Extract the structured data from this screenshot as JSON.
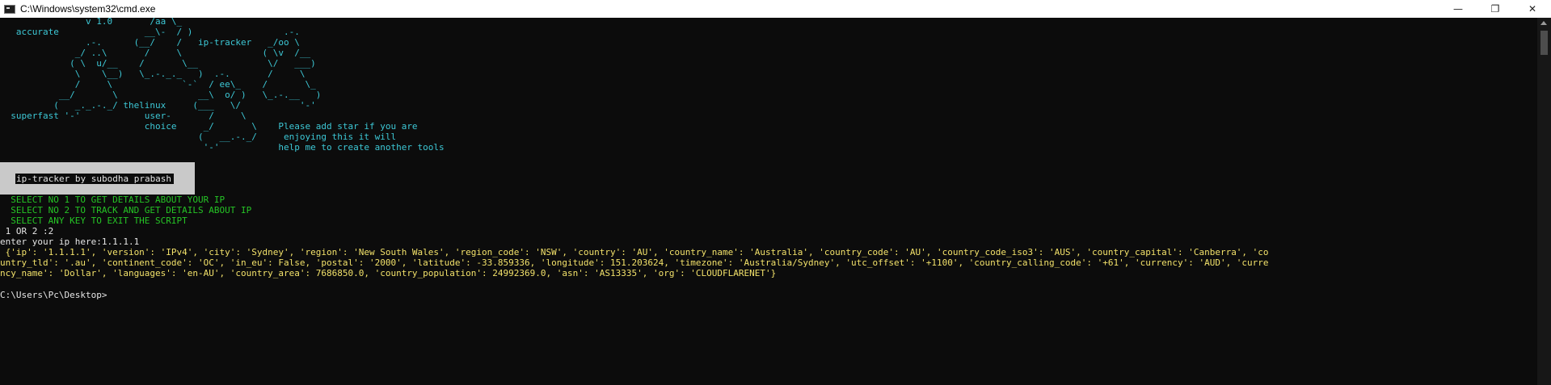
{
  "window": {
    "title": "C:\\Windows\\system32\\cmd.exe",
    "minimize": "—",
    "restore": "❐",
    "close": "✕"
  },
  "ascii_art": [
    "                v 1.0       /aa \\_",
    "   accurate                __\\-  / )                 .-.",
    "                .-.      (__/    /   ip-tracker   _/oo \\",
    "              _/ ..\\       /     \\               ( \\v  /__",
    "             ( \\  u/__    /       \\__             \\/   ___)",
    "              \\    \\__)   \\_.-._._   )  .-.       /     \\",
    "              /     \\             `-`  / ee\\_    /       \\_",
    "           __/       \\               __\\  o/ )   \\_.-.__   )",
    "          (   _._.-._/ thelinux     (___   \\/           '-'",
    "  superfast '-'            user-       /     \\",
    "                           choice     _/       \\    Please add star if you are",
    "                                     (   __.-._/     enjoying this it will",
    "                                      '-'           help me to create another tools"
  ],
  "banner": "ip-tracker by subodha prabash",
  "menu": [
    "  SELECT NO 1 TO GET DETAILS ABOUT YOUR IP",
    "  SELECT NO 2 TO TRACK AND GET DETAILS ABOUT IP",
    "  SELECT ANY KEY TO EXIT THE SCRIPT"
  ],
  "prompt_choice": " 1 OR 2 :2",
  "prompt_ip": "enter your ip here:1.1.1.1",
  "result_lines": [
    " {'ip': '1.1.1.1', 'version': 'IPv4', 'city': 'Sydney', 'region': 'New South Wales', 'region_code': 'NSW', 'country': 'AU', 'country_name': 'Australia', 'country_code': 'AU', 'country_code_iso3': 'AUS', 'country_capital': 'Canberra', 'co",
    "untry_tld': '.au', 'continent_code': 'OC', 'in_eu': False, 'postal': '2000', 'latitude': -33.859336, 'longitude': 151.203624, 'timezone': 'Australia/Sydney', 'utc_offset': '+1100', 'country_calling_code': '+61', 'currency': 'AUD', 'curre",
    "ncy_name': 'Dollar', 'languages': 'en-AU', 'country_area': 7686850.0, 'country_population': 24992369.0, 'asn': 'AS13335', 'org': 'CLOUDFLARENET'}"
  ],
  "shell_prompt": "C:\\Users\\Pc\\Desktop>"
}
